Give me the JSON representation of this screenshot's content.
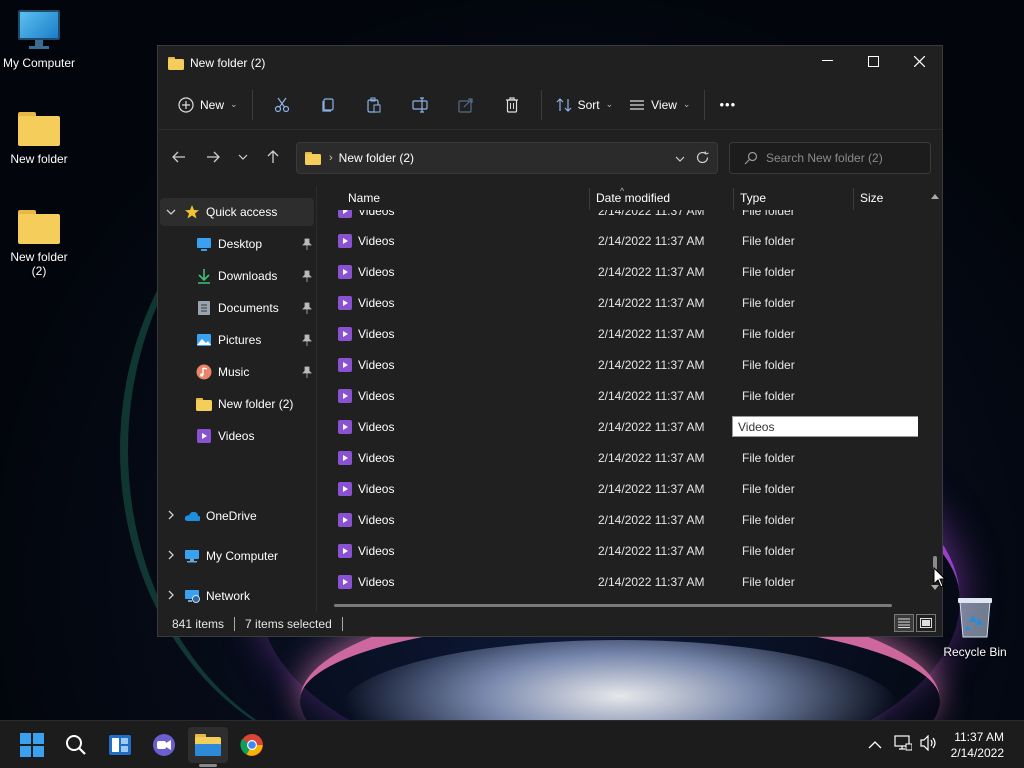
{
  "desktop": {
    "icons": [
      {
        "label": "My Computer"
      },
      {
        "label": "New folder"
      },
      {
        "label": "New folder\n(2)"
      }
    ],
    "recycle_bin": {
      "label": "Recycle Bin"
    }
  },
  "window": {
    "title": "New folder (2)",
    "controls": {
      "minimize": "—",
      "maximize": "☐",
      "close": "✕"
    },
    "toolbar": {
      "new_label": "New",
      "sort_label": "Sort",
      "view_label": "View",
      "more_label": "•••"
    },
    "address": {
      "crumb": "New folder (2)",
      "search_placeholder": "Search New folder (2)"
    },
    "nav_pane": {
      "quick_access": "Quick access",
      "items": [
        {
          "label": "Desktop",
          "pinned": true,
          "icon": "desktop-icon"
        },
        {
          "label": "Downloads",
          "pinned": true,
          "icon": "downloads-icon"
        },
        {
          "label": "Documents",
          "pinned": true,
          "icon": "documents-icon"
        },
        {
          "label": "Pictures",
          "pinned": true,
          "icon": "pictures-icon"
        },
        {
          "label": "Music",
          "pinned": true,
          "icon": "music-icon"
        },
        {
          "label": "New folder (2)",
          "pinned": false,
          "icon": "folder-icon"
        },
        {
          "label": "Videos",
          "pinned": false,
          "icon": "videos-icon"
        }
      ],
      "roots": [
        {
          "label": "OneDrive",
          "icon": "onedrive-icon"
        },
        {
          "label": "My Computer",
          "icon": "computer-icon"
        },
        {
          "label": "Network",
          "icon": "network-icon"
        }
      ]
    },
    "columns": {
      "name": "Name",
      "date": "Date modified",
      "type": "Type",
      "size": "Size"
    },
    "partial_row": {
      "name": "Videos",
      "date": "2/14/2022 11:37 AM",
      "type": "File folder"
    },
    "rows": [
      {
        "name": "Videos",
        "date": "2/14/2022 11:37 AM",
        "type": "File folder"
      },
      {
        "name": "Videos",
        "date": "2/14/2022 11:37 AM",
        "type": "File folder"
      },
      {
        "name": "Videos",
        "date": "2/14/2022 11:37 AM",
        "type": "File folder"
      },
      {
        "name": "Videos",
        "date": "2/14/2022 11:37 AM",
        "type": "File folder"
      },
      {
        "name": "Videos",
        "date": "2/14/2022 11:37 AM",
        "type": "File folder"
      },
      {
        "name": "Videos",
        "date": "2/14/2022 11:37 AM",
        "type": "File folder"
      },
      {
        "name": "Videos",
        "date": "2/14/2022 11:37 AM",
        "rename_value": "Videos"
      },
      {
        "name": "Videos",
        "date": "2/14/2022 11:37 AM",
        "type": "File folder"
      },
      {
        "name": "Videos",
        "date": "2/14/2022 11:37 AM",
        "type": "File folder"
      },
      {
        "name": "Videos",
        "date": "2/14/2022 11:37 AM",
        "type": "File folder"
      },
      {
        "name": "Videos",
        "date": "2/14/2022 11:37 AM",
        "type": "File folder"
      },
      {
        "name": "Videos",
        "date": "2/14/2022 11:37 AM",
        "type": "File folder"
      }
    ],
    "status": {
      "items": "841 items",
      "selected": "7 items selected"
    }
  },
  "taskbar": {
    "apps": [
      "start-icon",
      "search-icon",
      "widgets-icon",
      "chat-icon",
      "file-explorer-icon",
      "chrome-icon"
    ],
    "clock": {
      "time": "11:37 AM",
      "date": "2/14/2022"
    }
  },
  "colors": {
    "accent": "#f4cd5a",
    "videos_icon": "#8a52d0",
    "window_bg": "#202020",
    "taskbar_bg": "#1c1c1c"
  }
}
